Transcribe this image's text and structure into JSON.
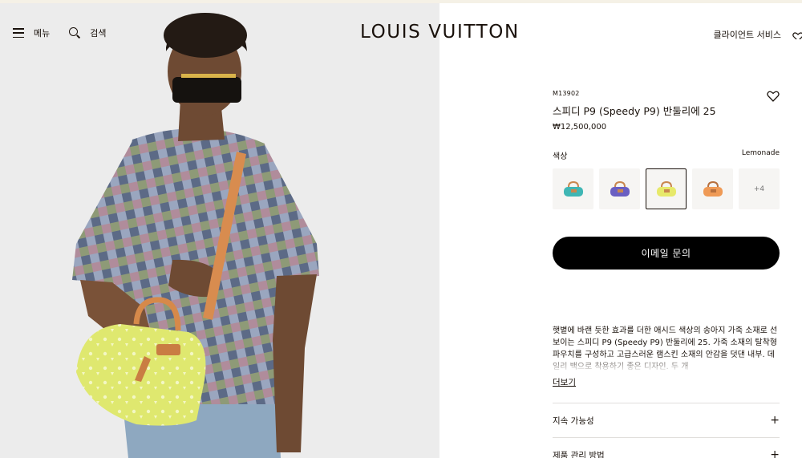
{
  "header": {
    "menu_label": "메뉴",
    "search_label": "검색",
    "logo_text": "LOUIS VUITTON",
    "client_service_label": "클라이언트 서비스"
  },
  "product": {
    "sku": "M13902",
    "name": "스피디 P9 (Speedy P9) 반둘리에 25",
    "price": "₩12,500,000",
    "color_label": "색상",
    "color_value": "Lemonade",
    "swatches": [
      {
        "name": "teal",
        "color": "#3fb6b4",
        "handle": "#c9874f"
      },
      {
        "name": "violet",
        "color": "#6a5fc2",
        "handle": "#c9874f"
      },
      {
        "name": "lemonade",
        "color": "#e7e96a",
        "handle": "#c9874f"
      },
      {
        "name": "orange",
        "color": "#ef9a56",
        "handle": "#c9874f"
      }
    ],
    "more_swatches": "+4",
    "cta_label": "이메일 문의",
    "description": "햇볕에 바랜 듯한 효과를 더한 애시드 색상의 송아지 가죽 소재로 선보이는 스피디 P9 (Speedy P9) 반둘리에 25. 가죽 소재의 탈착형 파우치를 구성하고 고급스러운 램스킨 소재의 안감을 덧댄 내부. 데일리 백으로 착용하기 좋은 디자인. 두 개",
    "read_more": "더보기",
    "accordion": [
      "지속 가능성",
      "제품 관리 방법"
    ]
  },
  "colors": {
    "text": "#19110b",
    "cta_bg": "#000000",
    "swatch_bg": "#f6f5f3",
    "hero_bg": "#ebebeb"
  }
}
